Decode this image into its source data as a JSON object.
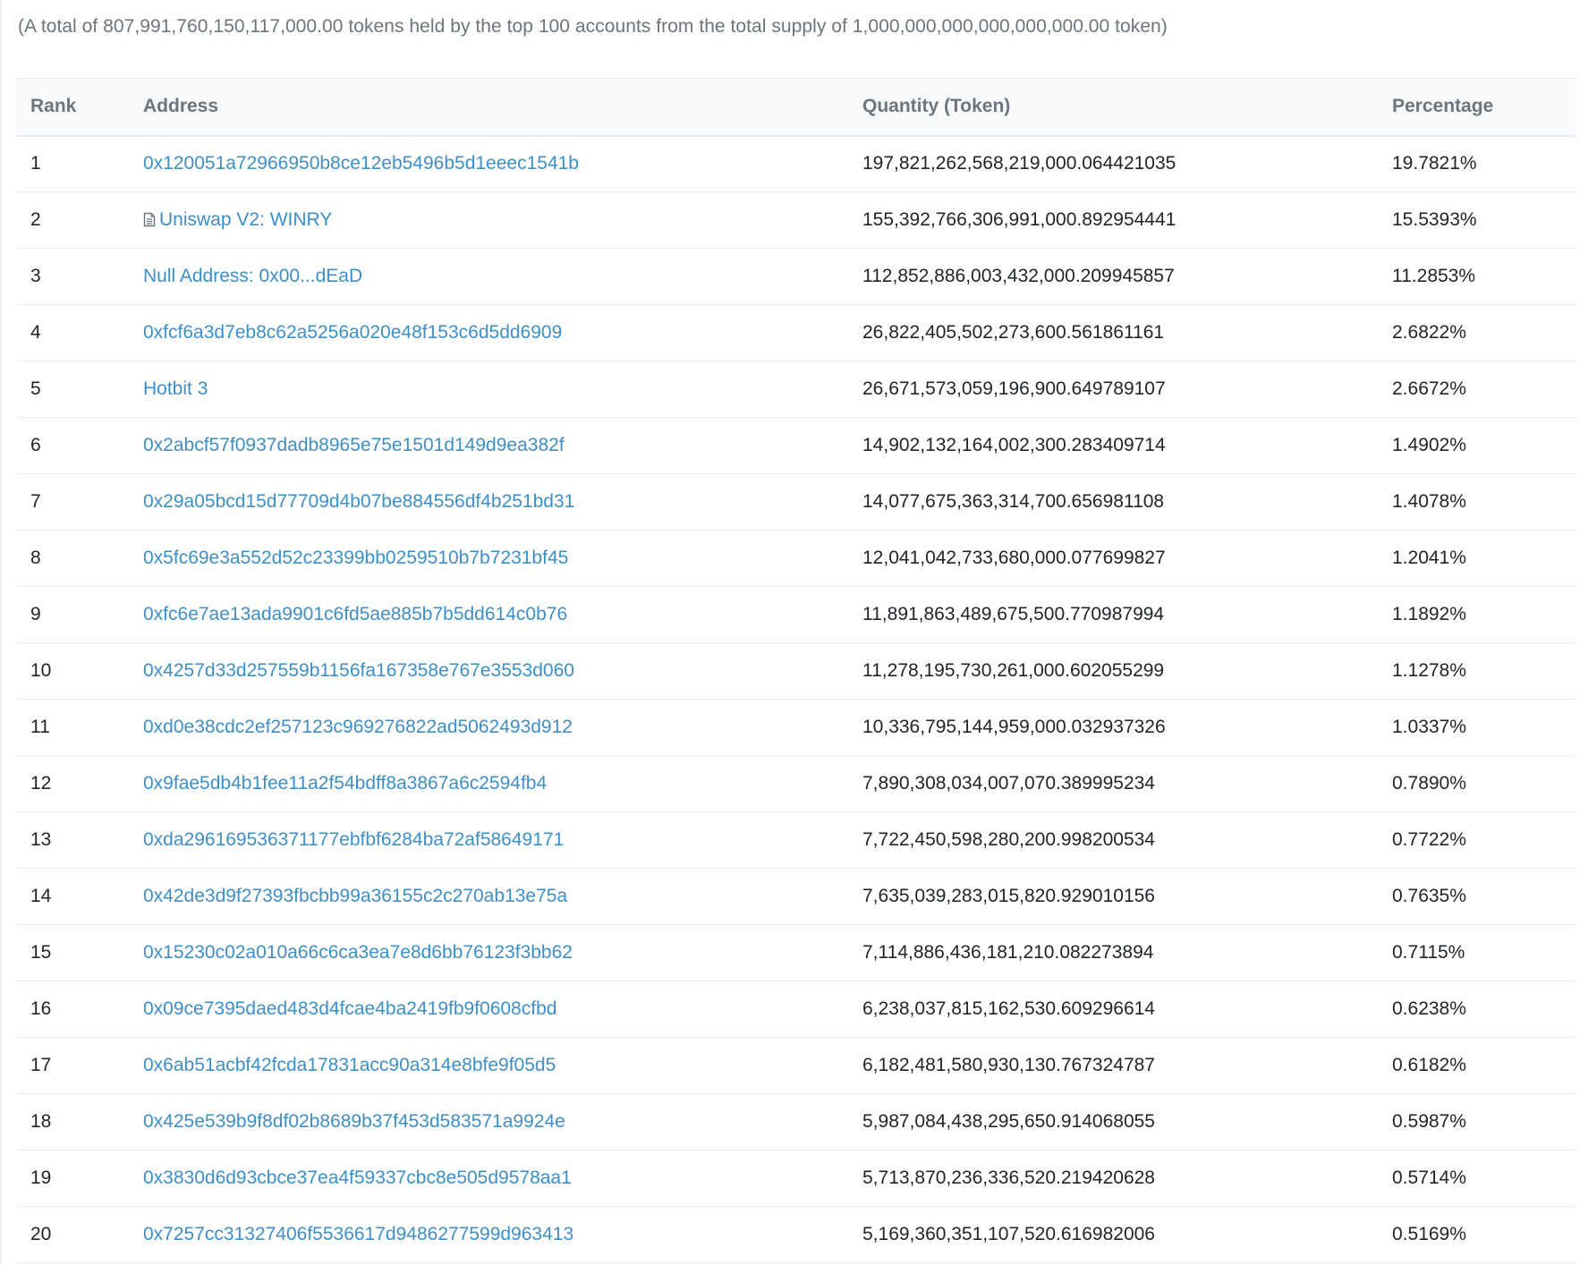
{
  "summary_text": "(A total of 807,991,760,150,117,000.00 tokens held by the top 100 accounts from the total supply of 1,000,000,000,000,000,000.00 token)",
  "table": {
    "headers": {
      "rank": "Rank",
      "address": "Address",
      "quantity": "Quantity (Token)",
      "percentage": "Percentage"
    },
    "rows": [
      {
        "rank": "1",
        "address": "0x120051a72966950b8ce12eb5496b5d1eeec1541b",
        "is_contract": false,
        "quantity": "197,821,262,568,219,000.064421035",
        "percentage": "19.7821%"
      },
      {
        "rank": "2",
        "address": "Uniswap V2: WINRY",
        "is_contract": true,
        "quantity": "155,392,766,306,991,000.892954441",
        "percentage": "15.5393%"
      },
      {
        "rank": "3",
        "address": "Null Address: 0x00...dEaD",
        "is_contract": false,
        "quantity": "112,852,886,003,432,000.209945857",
        "percentage": "11.2853%"
      },
      {
        "rank": "4",
        "address": "0xfcf6a3d7eb8c62a5256a020e48f153c6d5dd6909",
        "is_contract": false,
        "quantity": "26,822,405,502,273,600.561861161",
        "percentage": "2.6822%"
      },
      {
        "rank": "5",
        "address": "Hotbit 3",
        "is_contract": false,
        "quantity": "26,671,573,059,196,900.649789107",
        "percentage": "2.6672%"
      },
      {
        "rank": "6",
        "address": "0x2abcf57f0937dadb8965e75e1501d149d9ea382f",
        "is_contract": false,
        "quantity": "14,902,132,164,002,300.283409714",
        "percentage": "1.4902%"
      },
      {
        "rank": "7",
        "address": "0x29a05bcd15d77709d4b07be884556df4b251bd31",
        "is_contract": false,
        "quantity": "14,077,675,363,314,700.656981108",
        "percentage": "1.4078%"
      },
      {
        "rank": "8",
        "address": "0x5fc69e3a552d52c23399bb0259510b7b7231bf45",
        "is_contract": false,
        "quantity": "12,041,042,733,680,000.077699827",
        "percentage": "1.2041%"
      },
      {
        "rank": "9",
        "address": "0xfc6e7ae13ada9901c6fd5ae885b7b5dd614c0b76",
        "is_contract": false,
        "quantity": "11,891,863,489,675,500.770987994",
        "percentage": "1.1892%"
      },
      {
        "rank": "10",
        "address": "0x4257d33d257559b1156fa167358e767e3553d060",
        "is_contract": false,
        "quantity": "11,278,195,730,261,000.602055299",
        "percentage": "1.1278%"
      },
      {
        "rank": "11",
        "address": "0xd0e38cdc2ef257123c969276822ad5062493d912",
        "is_contract": false,
        "quantity": "10,336,795,144,959,000.032937326",
        "percentage": "1.0337%"
      },
      {
        "rank": "12",
        "address": "0x9fae5db4b1fee11a2f54bdff8a3867a6c2594fb4",
        "is_contract": false,
        "quantity": "7,890,308,034,007,070.389995234",
        "percentage": "0.7890%"
      },
      {
        "rank": "13",
        "address": "0xda296169536371177ebfbf6284ba72af58649171",
        "is_contract": false,
        "quantity": "7,722,450,598,280,200.998200534",
        "percentage": "0.7722%"
      },
      {
        "rank": "14",
        "address": "0x42de3d9f27393fbcbb99a36155c2c270ab13e75a",
        "is_contract": false,
        "quantity": "7,635,039,283,015,820.929010156",
        "percentage": "0.7635%"
      },
      {
        "rank": "15",
        "address": "0x15230c02a010a66c6ca3ea7e8d6bb76123f3bb62",
        "is_contract": false,
        "quantity": "7,114,886,436,181,210.082273894",
        "percentage": "0.7115%"
      },
      {
        "rank": "16",
        "address": "0x09ce7395daed483d4fcae4ba2419fb9f0608cfbd",
        "is_contract": false,
        "quantity": "6,238,037,815,162,530.609296614",
        "percentage": "0.6238%"
      },
      {
        "rank": "17",
        "address": "0x6ab51acbf42fcda17831acc90a314e8bfe9f05d5",
        "is_contract": false,
        "quantity": "6,182,481,580,930,130.767324787",
        "percentage": "0.6182%"
      },
      {
        "rank": "18",
        "address": "0x425e539b9f8df02b8689b37f453d583571a9924e",
        "is_contract": false,
        "quantity": "5,987,084,438,295,650.914068055",
        "percentage": "0.5987%"
      },
      {
        "rank": "19",
        "address": "0x3830d6d93cbce37ea4f59337cbc8e505d9578aa1",
        "is_contract": false,
        "quantity": "5,713,870,236,336,520.219420628",
        "percentage": "0.5714%"
      },
      {
        "rank": "20",
        "address": "0x7257cc31327406f5536617d9486277599d963413",
        "is_contract": false,
        "quantity": "5,169,360,351,107,520.616982006",
        "percentage": "0.5169%"
      }
    ]
  },
  "icons": {
    "contract": "contract-document-icon"
  },
  "colors": {
    "link": "#3d8fc6",
    "muted_text": "#6c757d",
    "body_text": "#212529",
    "border": "#e7eaf3",
    "header_bg": "#f8f9fa"
  }
}
